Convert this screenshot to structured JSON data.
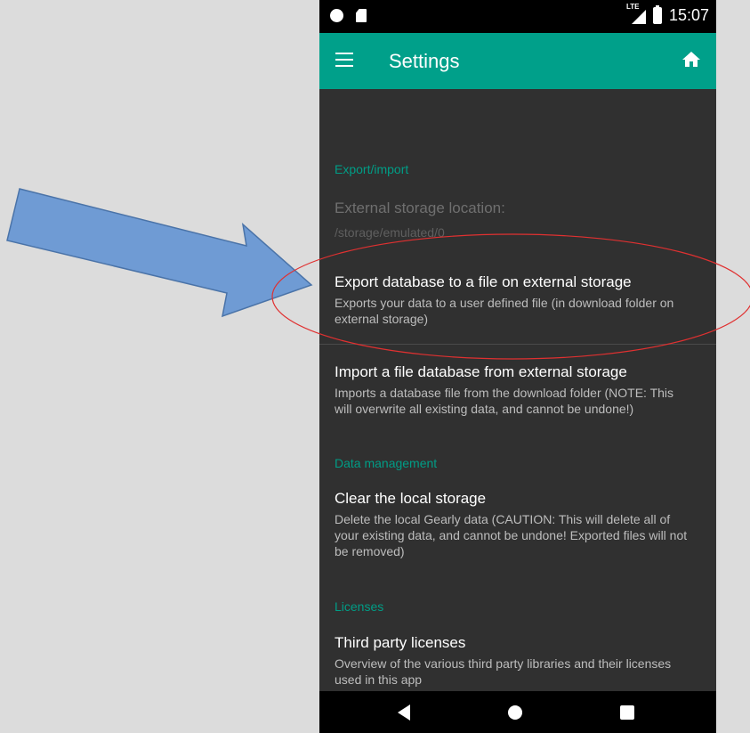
{
  "status_bar": {
    "network": "LTE",
    "time": "15:07"
  },
  "app_bar": {
    "title": "Settings",
    "menu_icon": "hamburger-menu-icon",
    "home_icon": "home-icon"
  },
  "sections": [
    {
      "header": "Export/import",
      "items": [
        {
          "title": "External storage location:",
          "summary": "/storage/emulated/0",
          "enabled": false
        },
        {
          "title": "Export database to a file on external storage",
          "summary": "Exports your data to a user defined file (in download folder on external storage)",
          "enabled": true
        },
        {
          "title": "Import a file database from external storage",
          "summary": "Imports a database file from the download folder (NOTE: This will overwrite all existing data, and cannot be undone!)",
          "enabled": true
        }
      ]
    },
    {
      "header": "Data management",
      "items": [
        {
          "title": "Clear the local storage",
          "summary": "Delete the local Gearly data (CAUTION: This will delete all of your existing data, and cannot be undone! Exported files will not be removed)",
          "enabled": true
        }
      ]
    },
    {
      "header": "Licenses",
      "items": [
        {
          "title": "Third party licenses",
          "summary": "Overview of the various third party libraries and their licenses used in this app",
          "enabled": true
        }
      ]
    }
  ],
  "nav_bar": {
    "back_icon": "back-triangle-icon",
    "home_icon": "home-circle-icon",
    "recents_icon": "recents-square-icon"
  },
  "colors": {
    "accent": "#00a08a",
    "section_header": "#009d86",
    "background": "#303030",
    "annotation_arrow": "#6f9bd4",
    "annotation_ellipse": "#e03030"
  }
}
